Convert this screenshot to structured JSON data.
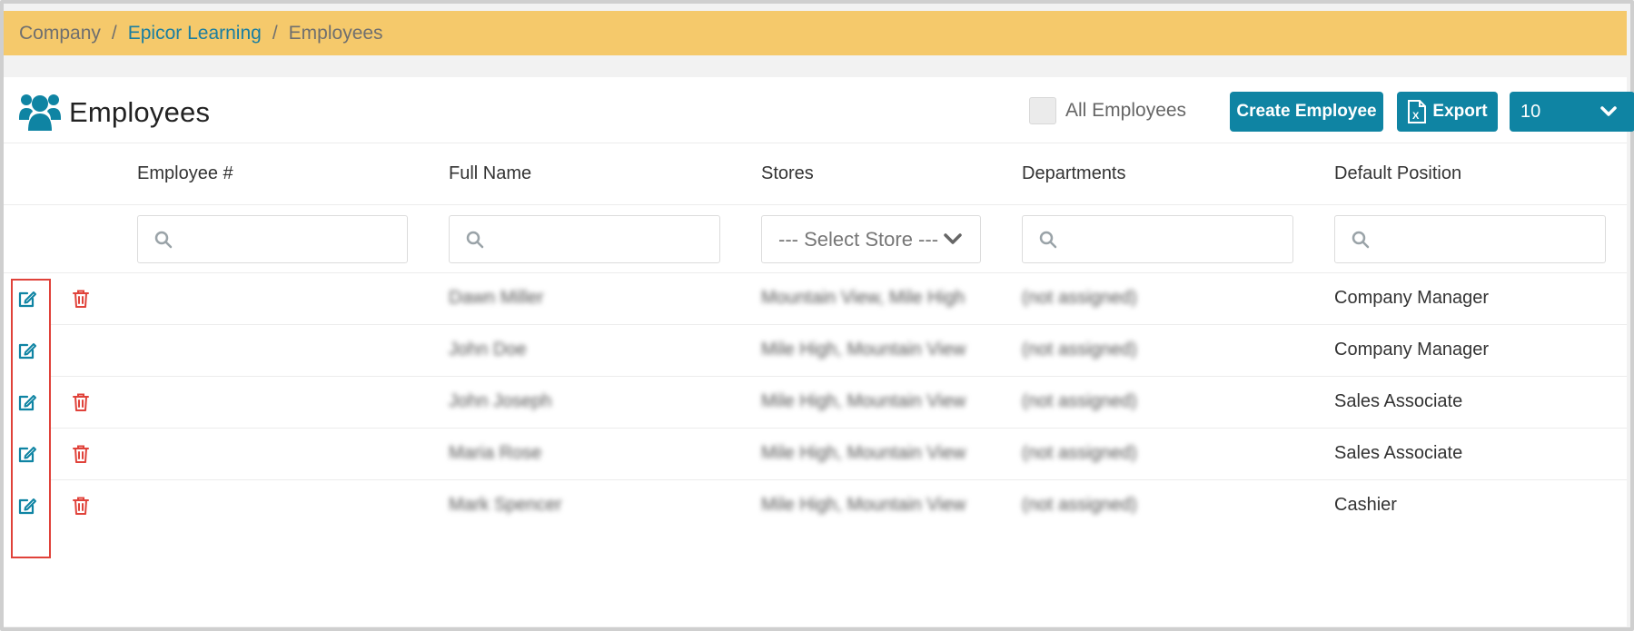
{
  "breadcrumb": {
    "items": [
      "Company",
      "Epicor Learning",
      "Employees"
    ],
    "separator": "/"
  },
  "header": {
    "title": "Employees",
    "all_employees_label": "All Employees",
    "all_employees_checked": false,
    "create_label": "Create Employee",
    "export_label": "Export",
    "page_size": "10"
  },
  "columns": [
    "Employee #",
    "Full Name",
    "Stores",
    "Departments",
    "Default Position"
  ],
  "filters": {
    "store_select": "--- Select Store ---"
  },
  "rows": [
    {
      "employee_no": "",
      "full_name": "Dawn Miller",
      "stores": "Mountain View, Mile High",
      "departments": "(not assigned)",
      "position": "Company Manager",
      "deletable": true
    },
    {
      "employee_no": "",
      "full_name": "John Doe",
      "stores": "Mile High, Mountain View",
      "departments": "(not assigned)",
      "position": "Company Manager",
      "deletable": false
    },
    {
      "employee_no": "",
      "full_name": "John Joseph",
      "stores": "Mile High, Mountain View",
      "departments": "(not assigned)",
      "position": "Sales Associate",
      "deletable": true
    },
    {
      "employee_no": "",
      "full_name": "Maria Rose",
      "stores": "Mile High, Mountain View",
      "departments": "(not assigned)",
      "position": "Sales Associate",
      "deletable": true
    },
    {
      "employee_no": "",
      "full_name": "Mark Spencer",
      "stores": "Mile High, Mountain View",
      "departments": "(not assigned)",
      "position": "Cashier",
      "deletable": true
    }
  ],
  "colors": {
    "breadcrumb_bg": "#f5c96b",
    "accent": "#0f84a3",
    "link": "#1a7ea1",
    "delete": "#e0423a",
    "highlight": "#e0423a"
  },
  "icons": {
    "title": "users-icon",
    "search": "search-icon",
    "export": "excel-icon",
    "dropdown": "chevron-down-icon",
    "edit": "edit-icon",
    "delete": "trash-icon"
  }
}
